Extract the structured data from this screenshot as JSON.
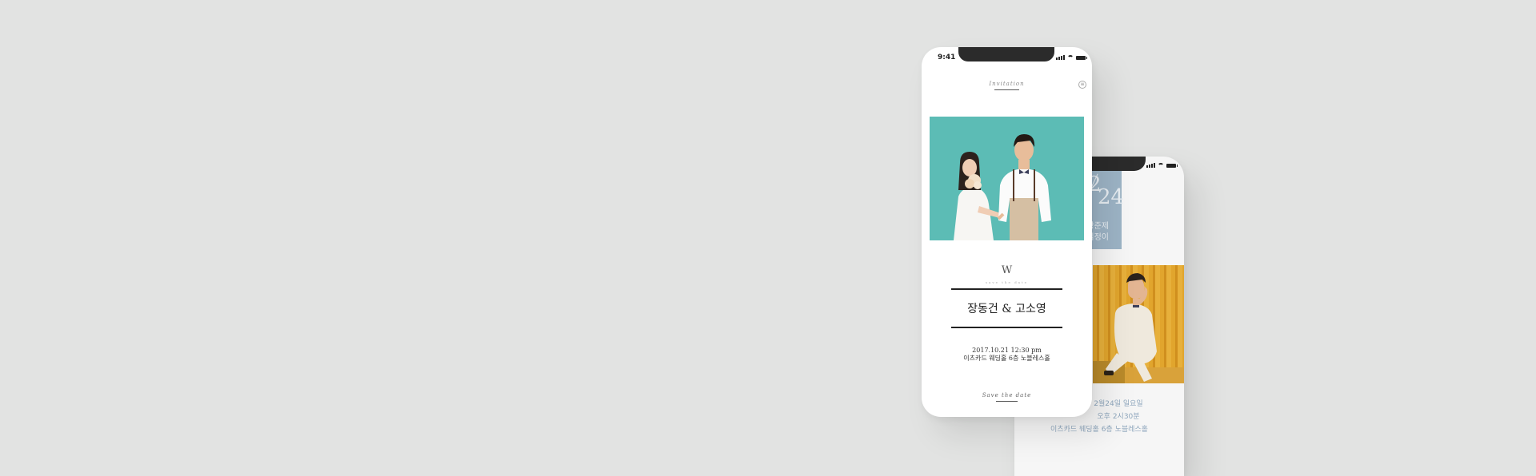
{
  "status_bar": {
    "time": "9:41"
  },
  "front": {
    "header_title": "Invitation",
    "monogram": "W",
    "monogram_caption": "save the date",
    "names": "장동건 & 고소영",
    "datetime": "2017.10.21 12:30 pm",
    "venue": "이츠카드 웨딩홀 6층 노블레스홀",
    "footer_title": "Save the date"
  },
  "back": {
    "date_month_fragment": "2",
    "date_day": "24",
    "groom_fragment": "장준제",
    "bride_fragment": "김정이",
    "info_line1": "2월24일 일요일",
    "info_line2": "오후 2시30분",
    "info_line3": "이츠카드 웨딩홀 6층 노블레스홀"
  },
  "colors": {
    "background": "#e2e3e2",
    "teal_photo_bg": "#5cbcb5",
    "date_block": "#9db4c6",
    "gold_photo_bg": "#e1a52d",
    "info_text": "#8fa7bd"
  },
  "icons": [
    "signal-icon",
    "wifi-icon",
    "battery-icon",
    "menu-icon"
  ]
}
